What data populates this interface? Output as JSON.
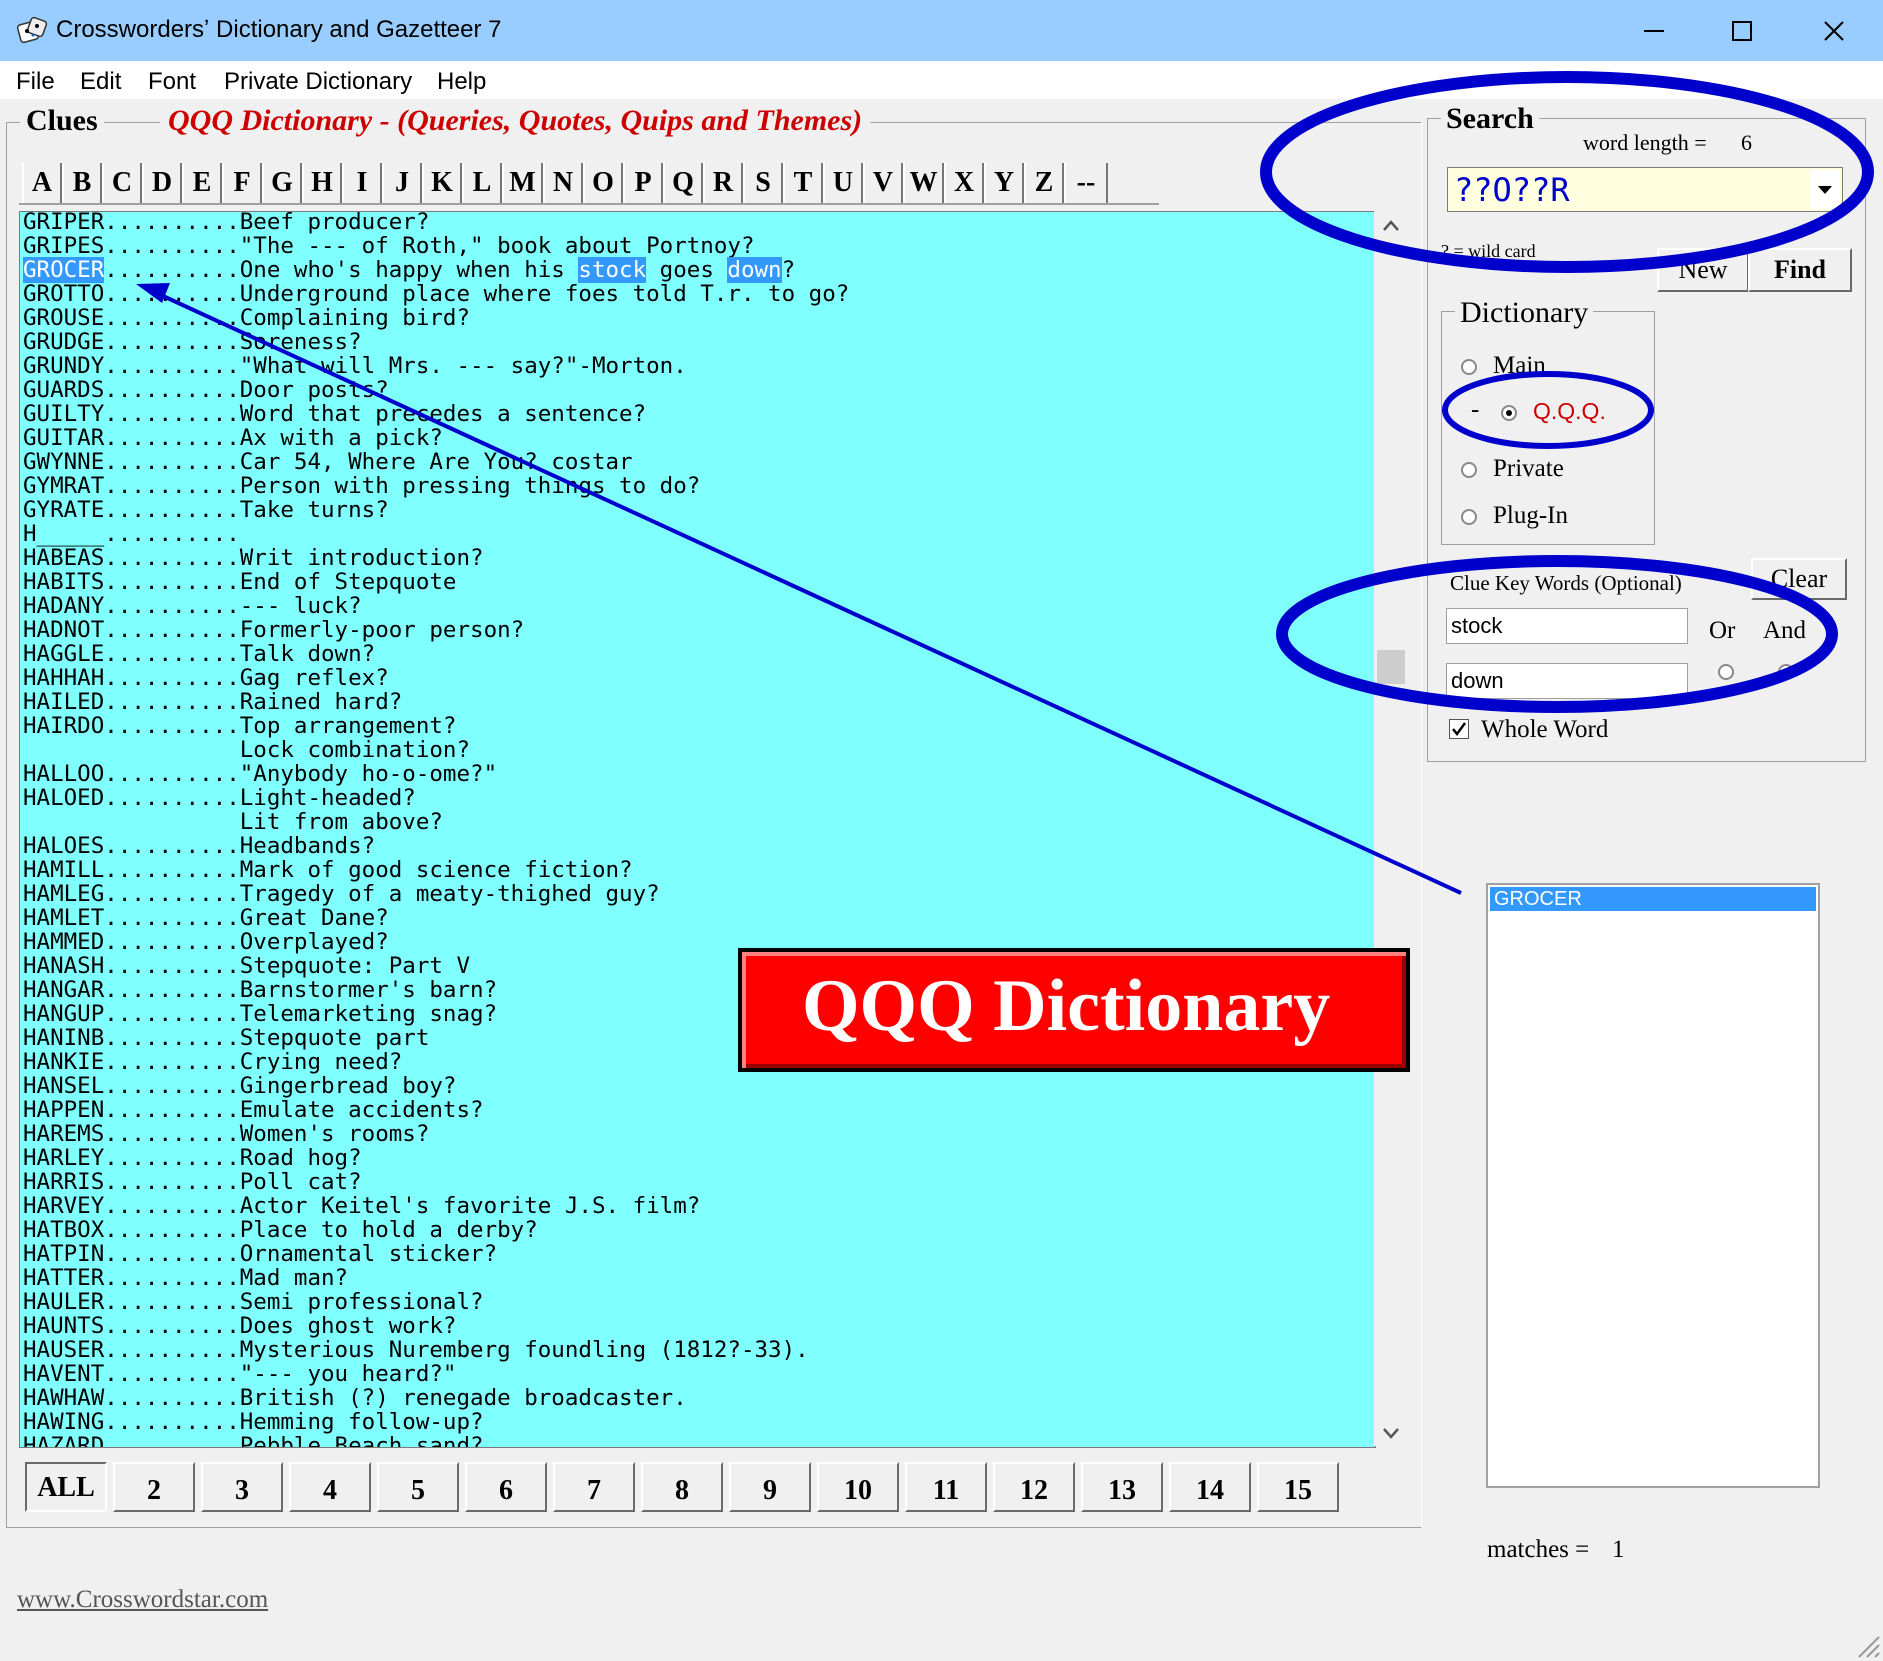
{
  "window": {
    "title": "Crosswordersʼ Dictionary and Gazetteer 7",
    "controls": [
      "minimize-icon",
      "maximize-icon",
      "close-icon"
    ]
  },
  "menu": [
    "File",
    "Edit",
    "Font",
    "Private Dictionary",
    "Help"
  ],
  "clues": {
    "label": "Clues",
    "dictionary_title": "QQQ Dictionary - (Queries, Quotes, Quips and Themes)",
    "letters": [
      "A",
      "B",
      "C",
      "D",
      "E",
      "F",
      "G",
      "H",
      "I",
      "J",
      "K",
      "L",
      "M",
      "N",
      "O",
      "P",
      "Q",
      "R",
      "S",
      "T",
      "U",
      "V",
      "W",
      "X",
      "Y",
      "Z",
      "--"
    ],
    "entries": [
      "GRIPER..........Beef producer?",
      "GRIPES..........\"The --- of Roth,\" book about Portnoy?",
      "GROCER..........One who's happy when his stock goes down?",
      "GROTTO..........Underground place where foes told T.r. to go?",
      "GROUSE..........Complaining bird?",
      "GRUDGE..........Soreness?",
      "GRUNDY..........\"What will Mrs. --- say?\"-Morton.",
      "GUARDS..........Door posts?",
      "GUILTY..........Word that precedes a sentence?",
      "GUITAR..........Ax with a pick?",
      "GWYNNE..........Car 54, Where Are You? costar",
      "GYMRAT..........Person with pressing things to do?",
      "GYRATE..........Take turns?",
      "H_____..........",
      "HABEAS..........Writ introduction?",
      "HABITS..........End of Stepquote",
      "HADANY..........--- luck?",
      "HADNOT..........Formerly-poor person?",
      "HAGGLE..........Talk down?",
      "HAHHAH..........Gag reflex?",
      "HAILED..........Rained hard?",
      "HAIRDO..........Top arrangement?",
      "                Lock combination?",
      "HALLOO..........\"Anybody ho-o-ome?\"",
      "HALOED..........Light-headed?",
      "                Lit from above?",
      "HALOES..........Headbands?",
      "HAMILL..........Mark of good science fiction?",
      "HAMLEG..........Tragedy of a meaty-thighed guy?",
      "HAMLET..........Great Dane?",
      "HAMMED..........Overplayed?",
      "HANASH..........Stepquote: Part V",
      "HANGAR..........Barnstormer's barn?",
      "HANGUP..........Telemarketing snag?",
      "HANINB..........Stepquote part",
      "HANKIE..........Crying need?",
      "HANSEL..........Gingerbread boy?",
      "HAPPEN..........Emulate accidents?",
      "HAREMS..........Women's rooms?",
      "HARLEY..........Road hog?",
      "HARRIS..........Poll cat?",
      "HARVEY..........Actor Keitel's favorite J.S. film?",
      "HATBOX..........Place to hold a derby?",
      "HATPIN..........Ornamental sticker?",
      "HATTER..........Mad man?",
      "HAULER..........Semi professional?",
      "HAUNTS..........Does ghost work?",
      "HAUSER..........Mysterious Nuremberg foundling (1812?-33).",
      "HAVENT..........\"--- you heard?\"",
      "HAWHAW..........British (?) renegade broadcaster.",
      "HAWING..........Hemming follow-up?",
      "HAZARD..........Pebble Beach sand?"
    ],
    "highlight": {
      "word": "GROCER",
      "keywords": [
        "stock",
        "down"
      ]
    },
    "lengths": [
      "ALL",
      "2",
      "3",
      "4",
      "5",
      "6",
      "7",
      "8",
      "9",
      "10",
      "11",
      "12",
      "13",
      "14",
      "15"
    ]
  },
  "search": {
    "label": "Search",
    "word_length_label": "word length =",
    "word_length_value": "6",
    "pattern": "??O??R",
    "wildcard_hint": "? = wild card",
    "new_label": "New",
    "find_label": "Find",
    "dictionary_label": "Dictionary",
    "dictionaries": [
      {
        "label": "Main",
        "selected": false,
        "prefix": ""
      },
      {
        "label": "Q.Q.Q.",
        "selected": true,
        "prefix": "-"
      },
      {
        "label": "Private",
        "selected": false,
        "prefix": ""
      },
      {
        "label": "Plug-In",
        "selected": false,
        "prefix": ""
      }
    ],
    "keywords_label": "Clue Key Words (Optional)",
    "clear_label": "Clear",
    "keyword1": "stock",
    "keyword2": "down",
    "or_label": "Or",
    "and_label": "And",
    "logic_selected": "And",
    "whole_word_label": "Whole Word",
    "whole_word_checked": true
  },
  "results": {
    "items": [
      "GROCER"
    ],
    "matches_label": "matches =",
    "matches_value": "1"
  },
  "banner": {
    "text": "QQQ Dictionary"
  },
  "footer": {
    "link": "www.Crosswordstar.com"
  },
  "colors": {
    "titlebar": "#99ccff",
    "list_bg": "#80ffff",
    "highlight": "#3399ff",
    "accent_red": "#cc0000",
    "annotation": "#0000cc"
  }
}
